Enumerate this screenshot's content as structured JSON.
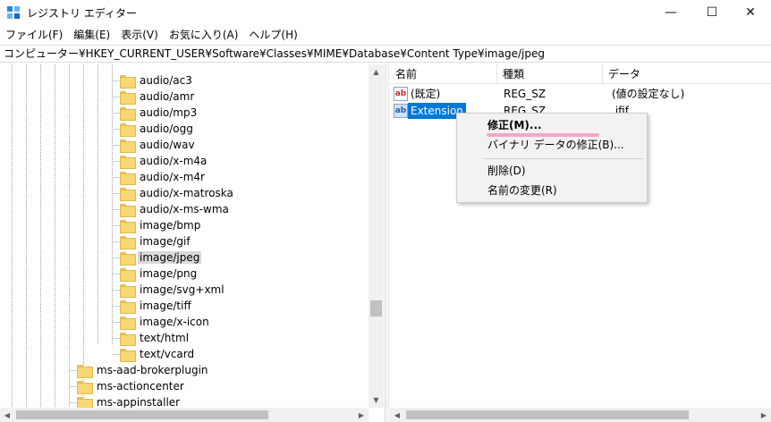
{
  "window": {
    "title": "レジストリ エディター",
    "minimize_glyph": "—",
    "maximize_glyph": "☐",
    "close_glyph": "✕"
  },
  "menu": [
    "ファイル(F)",
    "編集(E)",
    "表示(V)",
    "お気に入り(A)",
    "ヘルプ(H)"
  ],
  "address": "コンピューター¥HKEY_CURRENT_USER¥Software¥Classes¥MIME¥Database¥Content Type¥image/jpeg",
  "tree": {
    "items": [
      {
        "label": "audio/ac3",
        "selected": false
      },
      {
        "label": "audio/amr",
        "selected": false
      },
      {
        "label": "audio/mp3",
        "selected": false
      },
      {
        "label": "audio/ogg",
        "selected": false
      },
      {
        "label": "audio/wav",
        "selected": false
      },
      {
        "label": "audio/x-m4a",
        "selected": false
      },
      {
        "label": "audio/x-m4r",
        "selected": false
      },
      {
        "label": "audio/x-matroska",
        "selected": false
      },
      {
        "label": "audio/x-ms-wma",
        "selected": false
      },
      {
        "label": "image/bmp",
        "selected": false
      },
      {
        "label": "image/gif",
        "selected": false
      },
      {
        "label": "image/jpeg",
        "selected": true
      },
      {
        "label": "image/png",
        "selected": false
      },
      {
        "label": "image/svg+xml",
        "selected": false
      },
      {
        "label": "image/tiff",
        "selected": false
      },
      {
        "label": "image/x-icon",
        "selected": false
      },
      {
        "label": "text/html",
        "selected": false
      },
      {
        "label": "text/vcard",
        "selected": false
      }
    ],
    "parent_items": [
      {
        "label": "ms-aad-brokerplugin"
      },
      {
        "label": "ms-actioncenter"
      },
      {
        "label": "ms-appinstaller"
      }
    ]
  },
  "list": {
    "columns": [
      "名前",
      "種類",
      "データ"
    ],
    "rows": [
      {
        "name": "(既定)",
        "type": "REG_SZ",
        "data": "(値の設定なし)",
        "icon": "string-value-icon",
        "selected": false
      },
      {
        "name": "Extension",
        "type": "REG_SZ",
        "data": ".jfif",
        "icon": "string-value-icon",
        "selected": true
      }
    ]
  },
  "context_menu": {
    "items": [
      {
        "label": "修正(M)...",
        "bold": true
      },
      {
        "label": "バイナリ データの修正(B)...",
        "bold": false
      },
      {
        "label": "削除(D)",
        "bold": false
      },
      {
        "label": "名前の変更(R)",
        "bold": false
      }
    ]
  },
  "colors": {
    "selection_blue": "#0078d7",
    "folder_yellow": "#f8d775",
    "annotation_pink": "#f4a6c8"
  }
}
